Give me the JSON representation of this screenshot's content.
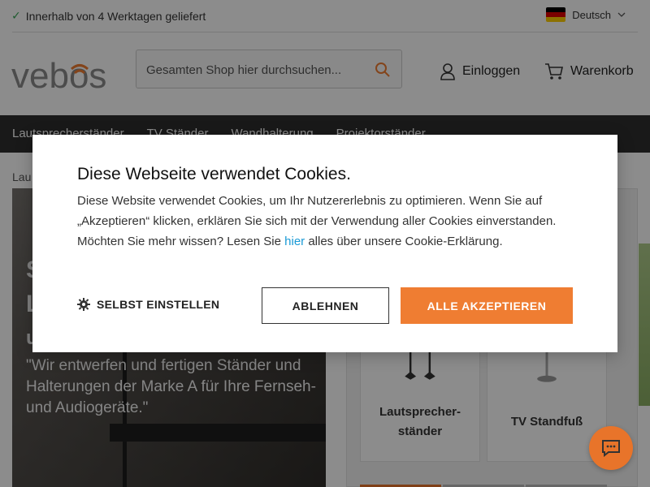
{
  "topbar": {
    "delivery_text": "Innerhalb von 4 Werktagen geliefert",
    "language": "Deutsch"
  },
  "header": {
    "logo_text": "vebos",
    "search_placeholder": "Gesamten Shop hier durchsuchen...",
    "account_label": "Einloggen",
    "cart_label": "Warenkorb"
  },
  "nav": {
    "items": [
      "Lautsprecherständer",
      "TV Ständer",
      "Wandhalterung",
      "Projektorständer"
    ]
  },
  "breadcrumb": "Lau",
  "hero": {
    "line1": "S",
    "line2": "L",
    "line3": "u",
    "quote": "\"Wir entwerfen und fertigen Ständer und Halterungen der Marke A für Ihre Fernseh- und Audiogeräte.\""
  },
  "products": [
    {
      "name_line1": "Lautsprecher-",
      "name_line2": "ständer"
    },
    {
      "name": "TV Standfuß"
    }
  ],
  "cookie": {
    "title": "Diese Webseite verwendet Cookies.",
    "body_before_link": "Diese Website verwendet Cookies, um Ihr Nutzererlebnis zu optimieren. Wenn Sie auf „Akzeptieren“ klicken, erklären Sie sich mit der Verwendung aller Cookies einverstanden. Möchten Sie mehr wissen? Lesen Sie ",
    "link_text": "hier",
    "body_after_link": " alles über unsere Cookie-Erklärung.",
    "self_config_label": "SELBST EINSTELLEN",
    "decline_label": "ABLEHNEN",
    "accept_label": "ALLE AKZEPTIEREN"
  },
  "colors": {
    "accent": "#ef7d32",
    "nav_bg": "#2f2f2f",
    "link": "#1a9ad6",
    "check": "#3aa757"
  },
  "icons": [
    "check-icon",
    "german-flag-icon",
    "chevron-down-icon",
    "search-icon",
    "user-icon",
    "cart-icon",
    "gear-icon",
    "chat-icon"
  ]
}
